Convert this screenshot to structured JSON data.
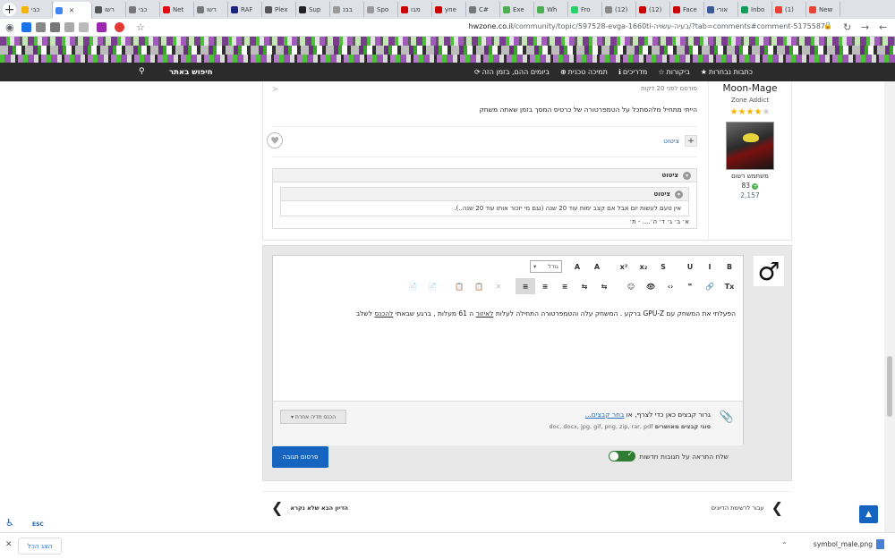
{
  "browser": {
    "tabs": [
      {
        "label": "כבי",
        "color": "#f4b400",
        "active": false
      },
      {
        "label": "",
        "color": "#4285f4",
        "active": true
      },
      {
        "label": "רשו",
        "color": "#555555",
        "active": false
      },
      {
        "label": "כבי",
        "color": "#777777",
        "active": false
      },
      {
        "label": "Net",
        "color": "#e50914",
        "active": false
      },
      {
        "label": "רשו",
        "color": "#777777",
        "active": false
      },
      {
        "label": "RAF",
        "color": "#1a237e",
        "active": false
      },
      {
        "label": "Plex",
        "color": "#555555",
        "active": false
      },
      {
        "label": "Sup",
        "color": "#222222",
        "active": false
      },
      {
        "label": "בבנ",
        "color": "#999999",
        "active": false
      },
      {
        "label": "Spo",
        "color": "#999999",
        "active": false
      },
      {
        "label": "מבו",
        "color": "#cc0000",
        "active": false
      },
      {
        "label": "yne",
        "color": "#cc0000",
        "active": false
      },
      {
        "label": "C#",
        "color": "#777777",
        "active": false
      },
      {
        "label": "Exe",
        "color": "#4caf50",
        "active": false
      },
      {
        "label": "Wh",
        "color": "#4caf50",
        "active": false
      },
      {
        "label": "Fro",
        "color": "#25d366",
        "active": false
      },
      {
        "label": "(12)",
        "color": "#888888",
        "active": false
      },
      {
        "label": "(12)",
        "color": "#cc0000",
        "active": false
      },
      {
        "label": "Face",
        "color": "#cc0000",
        "active": false
      },
      {
        "label": "אורי",
        "color": "#3b5998",
        "active": false
      },
      {
        "label": "Inbo",
        "color": "#0f9d58",
        "active": false
      },
      {
        "label": "(1) ",
        "color": "#ea4335",
        "active": false
      },
      {
        "label": "New",
        "color": "#ea4335",
        "active": false
      }
    ],
    "url_host": "hwzone.co.il",
    "url_rest": "/community/topic/597528-evga-1660ti-בעיה-עשויה/?tab=comments#comment-5175587"
  },
  "nav": {
    "items": [
      {
        "icon": "★",
        "label": "כתבות נבחרות"
      },
      {
        "icon": "☆",
        "label": "ביקורות"
      },
      {
        "icon": "ℹ",
        "label": "מדריכים"
      },
      {
        "icon": "⊕",
        "label": "תמיכה טכנית"
      },
      {
        "icon": "⟳",
        "label": "ביומים ההם, בזמן הזה"
      }
    ],
    "search_label": "חיפוש באתר"
  },
  "post": {
    "author_name": "Moon-Mage",
    "author_title": "Zone Addict",
    "rank": "משתמש רשום",
    "reputation": "83",
    "post_count": "2,157",
    "meta": "פורסם לפני 20 דקות",
    "body": "הייתי מתחיל מלהסתכל על הטמפרטורה של כרטיס המסך בזמן שאתה משחק",
    "quote_action": "ציטוט",
    "quote_outer_title": "ציטוט",
    "quote_inner_title": "ציטוט",
    "quote_inner_text": "אין טעם לעשות יום אבל אם קצב ימות עוד 20 שנה (נגם מי יזכור אותו עוד 20 שנה..).",
    "quote_tail": "א׳ ב׳ ג׳ ד׳ ה׳.... - ת׳"
  },
  "editor": {
    "toolbar_row1": [
      "B",
      "I",
      "U",
      "S",
      "x₂",
      "x²",
      "A",
      "A"
    ],
    "font_size_label": "גודל",
    "toolbar_row2": [
      "Tx",
      "🔗",
      "❞",
      "‹›",
      "👁",
      "☺",
      "⇆",
      "⇆",
      "≡",
      "≡",
      "≡",
      "✕",
      "📋",
      "📋",
      "📄",
      "📄"
    ],
    "text_before": "הפעלתי את המשחק עם GPU-Z ברקע . המשחק עלה והטמפרטורה התחילה לעלות",
    "text_mid1": "לאיזור",
    "text_mid2": "ה 61 מעלות , ברגע שבאתי",
    "text_mid3": "להכנס",
    "text_after": "לשלב",
    "attach_prompt": "גרור קבצים כאן כדי לצרף, או",
    "attach_link": "בחר קבצים...",
    "attach_types_label": "סוגי קבצים מאושרים",
    "attach_types": "doc, docx, jpg, gif, png, zip, rar, pdf",
    "media_button": "הכנס מדיה אחרת ▾",
    "notify_label": "שלח התראה על תגובות חדשות",
    "submit": "פרסום תגובה"
  },
  "pager": {
    "next_label": "עבור לרשימת הדיונים",
    "prev_label": "הדיון הבא שלא נקרא"
  },
  "accessibility": {
    "esc": "ESC"
  },
  "downloads": {
    "file_name": "symbol_male.png",
    "show_all": "הצג הכל"
  }
}
